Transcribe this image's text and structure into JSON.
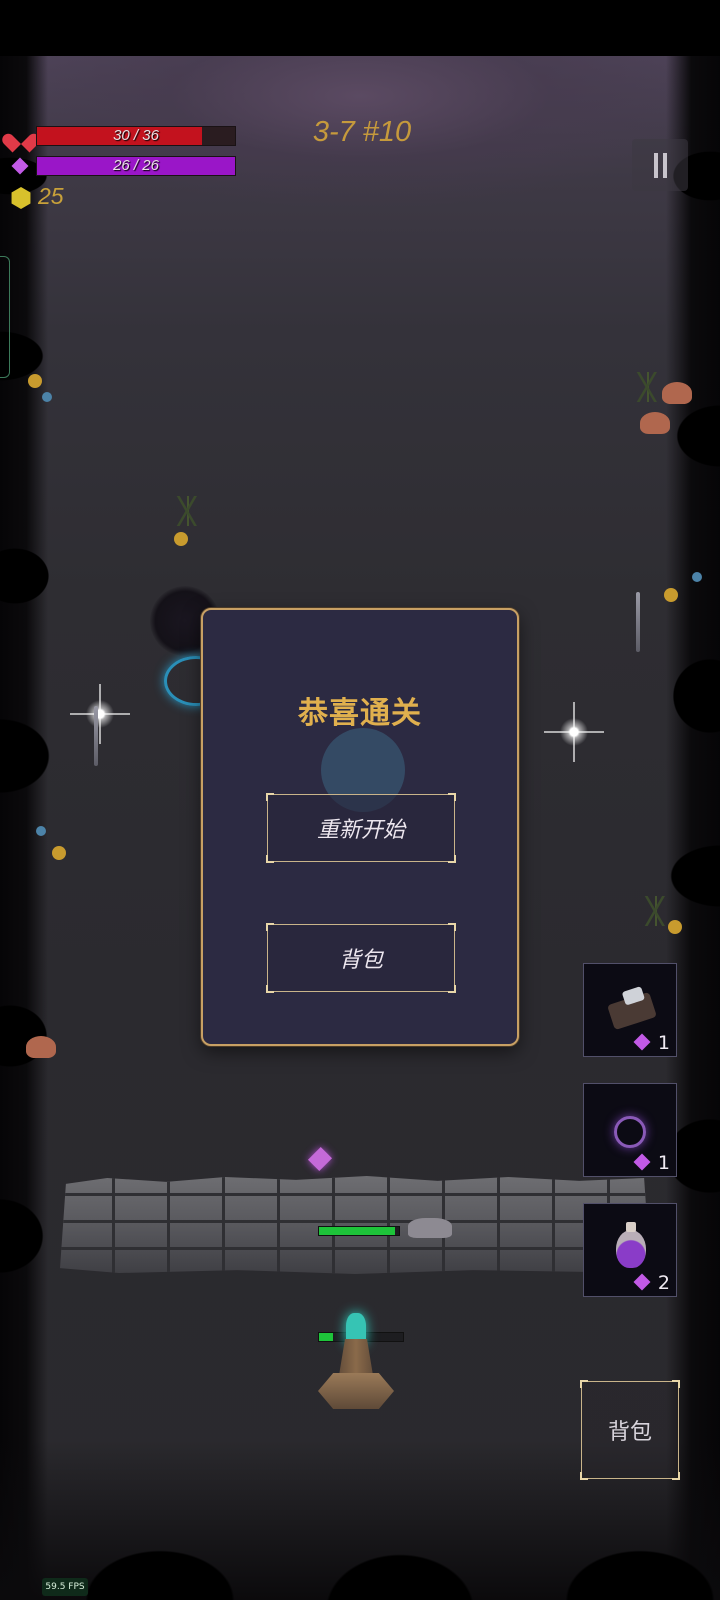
{
  "hud": {
    "hp": {
      "current": 30,
      "max": 36,
      "label": "30 / 36",
      "color": "#c3121e"
    },
    "mana": {
      "current": 26,
      "max": 26,
      "label": "26 / 26",
      "color": "#9a16c8"
    },
    "gold": "25",
    "level": "3-7 #10"
  },
  "dialog": {
    "title": "恭喜通关",
    "restart_label": "重新开始",
    "backpack_label": "背包"
  },
  "skills": [
    {
      "icon": "scroll-icon",
      "cost": "1"
    },
    {
      "icon": "vortex-icon",
      "cost": "1"
    },
    {
      "icon": "potion-icon",
      "cost": "2"
    }
  ],
  "backpack_button_label": "背包",
  "fps": "59.5 FPS",
  "wall_hp": {
    "fraction": 0.95
  },
  "tower_hp": {
    "fraction": 0.17
  },
  "colors": {
    "accent_gold": "#c69a3c",
    "panel_bg": "#2c2a42",
    "panel_border": "#c8a064"
  }
}
